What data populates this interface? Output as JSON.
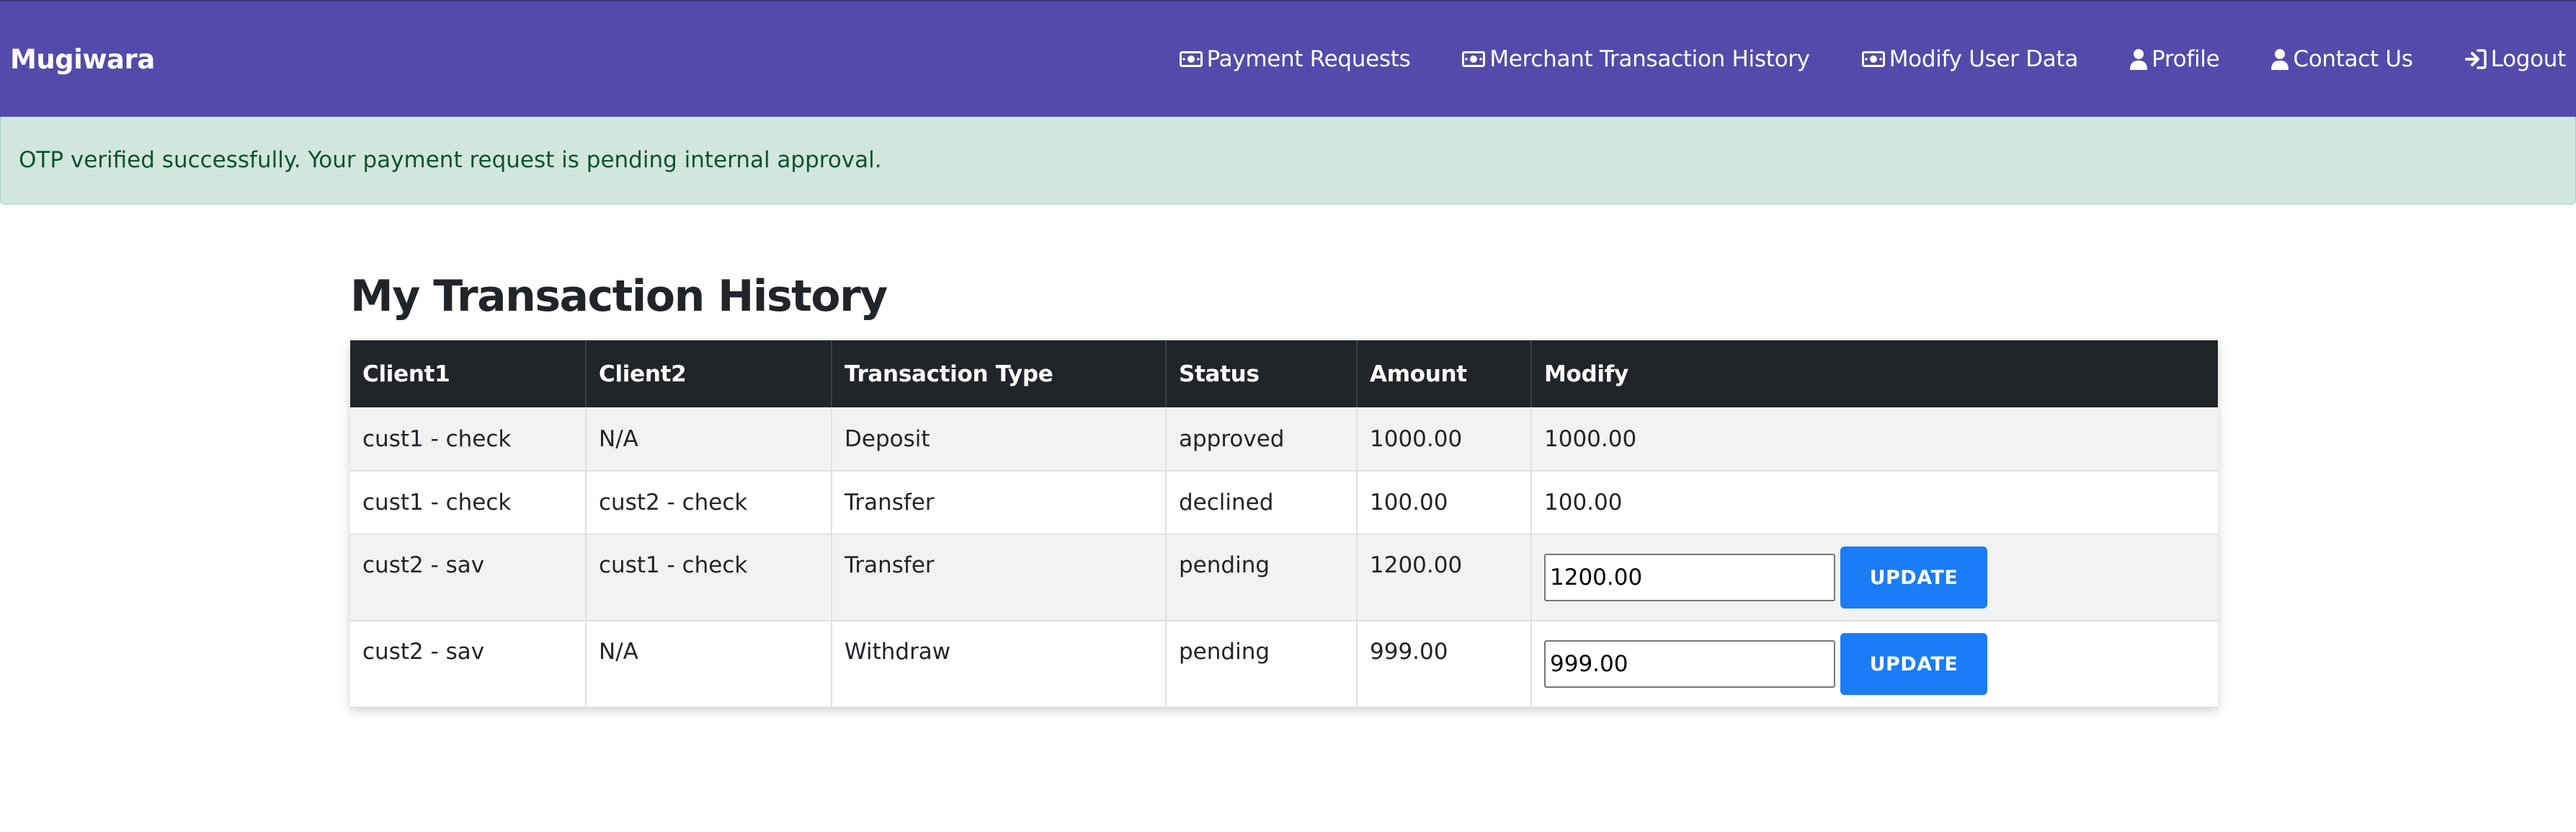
{
  "navbar": {
    "brand": "Mugiwara",
    "links": [
      {
        "label": "Payment Requests",
        "icon": "money-bill-icon"
      },
      {
        "label": "Merchant Transaction History",
        "icon": "money-bill-icon"
      },
      {
        "label": "Modify User Data",
        "icon": "money-bill-icon"
      },
      {
        "label": "Profile",
        "icon": "user-icon"
      },
      {
        "label": "Contact Us",
        "icon": "user-icon"
      },
      {
        "label": "Logout",
        "icon": "sign-out-icon"
      }
    ],
    "background_color": "#544aab"
  },
  "alert": {
    "message": "OTP verified successfully. Your payment request is pending internal approval.",
    "background_color": "#d1e7dd",
    "text_color": "#0f5132"
  },
  "main": {
    "title": "My Transaction History",
    "table": {
      "headers": [
        "Client1",
        "Client2",
        "Transaction Type",
        "Status",
        "Amount",
        "Modify"
      ],
      "rows": [
        {
          "client1": "cust1 - check",
          "client2": "N/A",
          "type": "Deposit",
          "status": "approved",
          "amount": "1000.00",
          "modify_text": "1000.00"
        },
        {
          "client1": "cust1 - check",
          "client2": "cust2 - check",
          "type": "Transfer",
          "status": "declined",
          "amount": "100.00",
          "modify_text": "100.00"
        },
        {
          "client1": "cust2 - sav",
          "client2": "cust1 - check",
          "type": "Transfer",
          "status": "pending",
          "amount": "1200.00",
          "modify_input": "1200.00",
          "button_label": "UPDATE"
        },
        {
          "client1": "cust2 - sav",
          "client2": "N/A",
          "type": "Withdraw",
          "status": "pending",
          "amount": "999.00",
          "modify_input": "999.00",
          "button_label": "UPDATE"
        }
      ],
      "header_color": "#212529",
      "button_color": "#1a7cf7"
    }
  }
}
